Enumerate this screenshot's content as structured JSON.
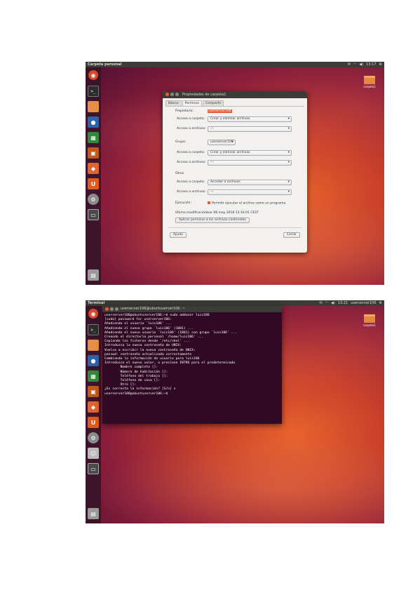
{
  "shot1": {
    "topbar": {
      "title": "Carpeta personal",
      "indicators": [
        "✉",
        "◠",
        "◀)",
        "13:17",
        "⚙"
      ]
    },
    "desktop_icon_label": "carpeta1",
    "dialog": {
      "title": "Propiedades de carpeta1",
      "tabs": [
        "Básico",
        "Permisos",
        "Compartir"
      ],
      "owner_label": "Propietario:",
      "owner_value": "userserver106",
      "folder_access_label": "Acceso a carpeta:",
      "file_access_label": "Acceso a archivos:",
      "owner_folder_access": "Crear y eliminar archivos",
      "owner_file_access": "---",
      "group_label": "Grupo:",
      "group_value": "userserver106",
      "group_folder_access": "Crear y eliminar archivos",
      "group_file_access": "---",
      "others_label": "Otros",
      "others_folder_access": "Acceder a archivos",
      "others_file_access": "---",
      "exec_label": "Ejecución:",
      "exec_value": "Permitir ejecutar el archivo como un programa",
      "modified_label": "Última modificación:",
      "modified_value": "mar 08 may 2018 13:16:01 CEST",
      "apply_button": "Aplicar permisos a los archivos contenidos",
      "help_button": "Ayuda",
      "close_button": "Cerrar"
    }
  },
  "shot2": {
    "topbar": {
      "title": "Terminal",
      "indicators": [
        "✉",
        "◠",
        "◀)",
        "13:21",
        "userserver106",
        "⚙"
      ]
    },
    "desktop_icon_label": "carpeta1",
    "terminal": {
      "title": "userserver106@ubuntuserver106: ~",
      "lines": [
        "userserver106@ubuntuserver106:~$ sudo adduser luis106",
        "[sudo] password for userserver106:",
        "Añadiendo el usuario `luis106' ...",
        "Añadiendo el nuevo grupo `luis106' (1001) ...",
        "Añadiendo el nuevo usuario `luis106' (1001) con grupo `luis106' ...",
        "Creando el directorio personal `/home/luis106' ...",
        "Copiando los ficheros desde `/etc/skel' ...",
        "Introduzca la nueva contraseña de UNIX:",
        "Vuelva a escribir la nueva contraseña de UNIX:",
        "passwd: contraseña actualizada correctamente",
        "Cambiando la información de usuario para luis106",
        "Introduzca el nuevo valor, o presione INTRO para el predeterminado",
        "        Nombre completo []:",
        "        Número de habitación []:",
        "        Teléfono del trabajo []:",
        "        Teléfono de casa []:",
        "        Otro []:",
        "¿Es correcta la información? [S/n] s",
        "userserver106@ubuntuserver106:~$"
      ]
    }
  },
  "launcher_icons": [
    "dash-icon",
    "terminal-icon",
    "files-icon",
    "firefox-icon",
    "libreoffice-calc-icon",
    "libreoffice-impress-icon",
    "software-center-icon",
    "ubuntu-one-icon",
    "system-settings-icon",
    "workspaces-icon",
    "trash-icon"
  ]
}
